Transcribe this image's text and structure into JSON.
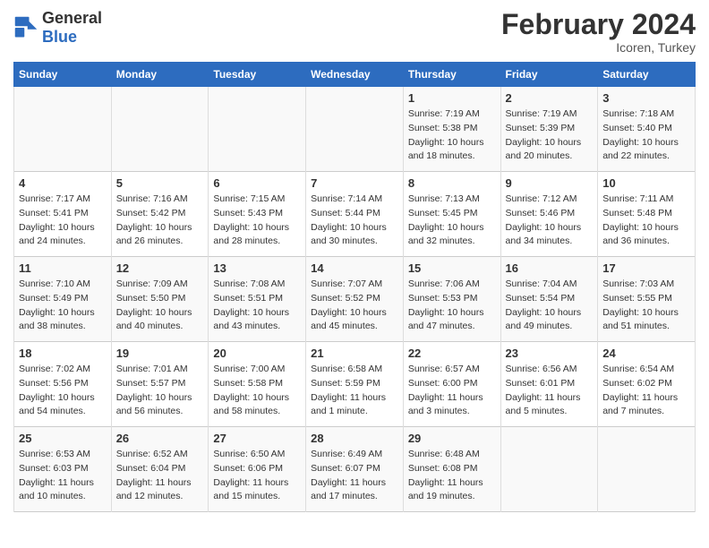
{
  "header": {
    "logo_general": "General",
    "logo_blue": "Blue",
    "title": "February 2024",
    "location": "Icoren, Turkey"
  },
  "days_of_week": [
    "Sunday",
    "Monday",
    "Tuesday",
    "Wednesday",
    "Thursday",
    "Friday",
    "Saturday"
  ],
  "weeks": [
    {
      "days": [
        {
          "num": "",
          "info": ""
        },
        {
          "num": "",
          "info": ""
        },
        {
          "num": "",
          "info": ""
        },
        {
          "num": "",
          "info": ""
        },
        {
          "num": "1",
          "info": "Sunrise: 7:19 AM\nSunset: 5:38 PM\nDaylight: 10 hours and 18 minutes."
        },
        {
          "num": "2",
          "info": "Sunrise: 7:19 AM\nSunset: 5:39 PM\nDaylight: 10 hours and 20 minutes."
        },
        {
          "num": "3",
          "info": "Sunrise: 7:18 AM\nSunset: 5:40 PM\nDaylight: 10 hours and 22 minutes."
        }
      ]
    },
    {
      "days": [
        {
          "num": "4",
          "info": "Sunrise: 7:17 AM\nSunset: 5:41 PM\nDaylight: 10 hours and 24 minutes."
        },
        {
          "num": "5",
          "info": "Sunrise: 7:16 AM\nSunset: 5:42 PM\nDaylight: 10 hours and 26 minutes."
        },
        {
          "num": "6",
          "info": "Sunrise: 7:15 AM\nSunset: 5:43 PM\nDaylight: 10 hours and 28 minutes."
        },
        {
          "num": "7",
          "info": "Sunrise: 7:14 AM\nSunset: 5:44 PM\nDaylight: 10 hours and 30 minutes."
        },
        {
          "num": "8",
          "info": "Sunrise: 7:13 AM\nSunset: 5:45 PM\nDaylight: 10 hours and 32 minutes."
        },
        {
          "num": "9",
          "info": "Sunrise: 7:12 AM\nSunset: 5:46 PM\nDaylight: 10 hours and 34 minutes."
        },
        {
          "num": "10",
          "info": "Sunrise: 7:11 AM\nSunset: 5:48 PM\nDaylight: 10 hours and 36 minutes."
        }
      ]
    },
    {
      "days": [
        {
          "num": "11",
          "info": "Sunrise: 7:10 AM\nSunset: 5:49 PM\nDaylight: 10 hours and 38 minutes."
        },
        {
          "num": "12",
          "info": "Sunrise: 7:09 AM\nSunset: 5:50 PM\nDaylight: 10 hours and 40 minutes."
        },
        {
          "num": "13",
          "info": "Sunrise: 7:08 AM\nSunset: 5:51 PM\nDaylight: 10 hours and 43 minutes."
        },
        {
          "num": "14",
          "info": "Sunrise: 7:07 AM\nSunset: 5:52 PM\nDaylight: 10 hours and 45 minutes."
        },
        {
          "num": "15",
          "info": "Sunrise: 7:06 AM\nSunset: 5:53 PM\nDaylight: 10 hours and 47 minutes."
        },
        {
          "num": "16",
          "info": "Sunrise: 7:04 AM\nSunset: 5:54 PM\nDaylight: 10 hours and 49 minutes."
        },
        {
          "num": "17",
          "info": "Sunrise: 7:03 AM\nSunset: 5:55 PM\nDaylight: 10 hours and 51 minutes."
        }
      ]
    },
    {
      "days": [
        {
          "num": "18",
          "info": "Sunrise: 7:02 AM\nSunset: 5:56 PM\nDaylight: 10 hours and 54 minutes."
        },
        {
          "num": "19",
          "info": "Sunrise: 7:01 AM\nSunset: 5:57 PM\nDaylight: 10 hours and 56 minutes."
        },
        {
          "num": "20",
          "info": "Sunrise: 7:00 AM\nSunset: 5:58 PM\nDaylight: 10 hours and 58 minutes."
        },
        {
          "num": "21",
          "info": "Sunrise: 6:58 AM\nSunset: 5:59 PM\nDaylight: 11 hours and 1 minute."
        },
        {
          "num": "22",
          "info": "Sunrise: 6:57 AM\nSunset: 6:00 PM\nDaylight: 11 hours and 3 minutes."
        },
        {
          "num": "23",
          "info": "Sunrise: 6:56 AM\nSunset: 6:01 PM\nDaylight: 11 hours and 5 minutes."
        },
        {
          "num": "24",
          "info": "Sunrise: 6:54 AM\nSunset: 6:02 PM\nDaylight: 11 hours and 7 minutes."
        }
      ]
    },
    {
      "days": [
        {
          "num": "25",
          "info": "Sunrise: 6:53 AM\nSunset: 6:03 PM\nDaylight: 11 hours and 10 minutes."
        },
        {
          "num": "26",
          "info": "Sunrise: 6:52 AM\nSunset: 6:04 PM\nDaylight: 11 hours and 12 minutes."
        },
        {
          "num": "27",
          "info": "Sunrise: 6:50 AM\nSunset: 6:06 PM\nDaylight: 11 hours and 15 minutes."
        },
        {
          "num": "28",
          "info": "Sunrise: 6:49 AM\nSunset: 6:07 PM\nDaylight: 11 hours and 17 minutes."
        },
        {
          "num": "29",
          "info": "Sunrise: 6:48 AM\nSunset: 6:08 PM\nDaylight: 11 hours and 19 minutes."
        },
        {
          "num": "",
          "info": ""
        },
        {
          "num": "",
          "info": ""
        }
      ]
    }
  ]
}
